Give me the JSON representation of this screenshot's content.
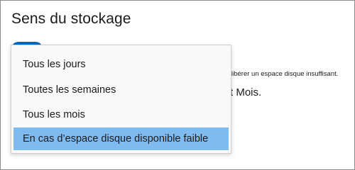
{
  "header": {
    "title": "Sens du stockage"
  },
  "background": {
    "description_fragment": "libérer un espace disque insuffisant.",
    "value_fragment": "t Mois."
  },
  "dropdown": {
    "options": [
      {
        "label": "Tous les jours"
      },
      {
        "label": "Toutes les semaines"
      },
      {
        "label": "Tous les mois"
      },
      {
        "label": "En cas d’espace disque disponible faible"
      }
    ],
    "selected_index": 3
  },
  "colors": {
    "accent": "#0067c0",
    "selected_highlight": "#7fbaf0",
    "border": "#8a8a8a"
  }
}
